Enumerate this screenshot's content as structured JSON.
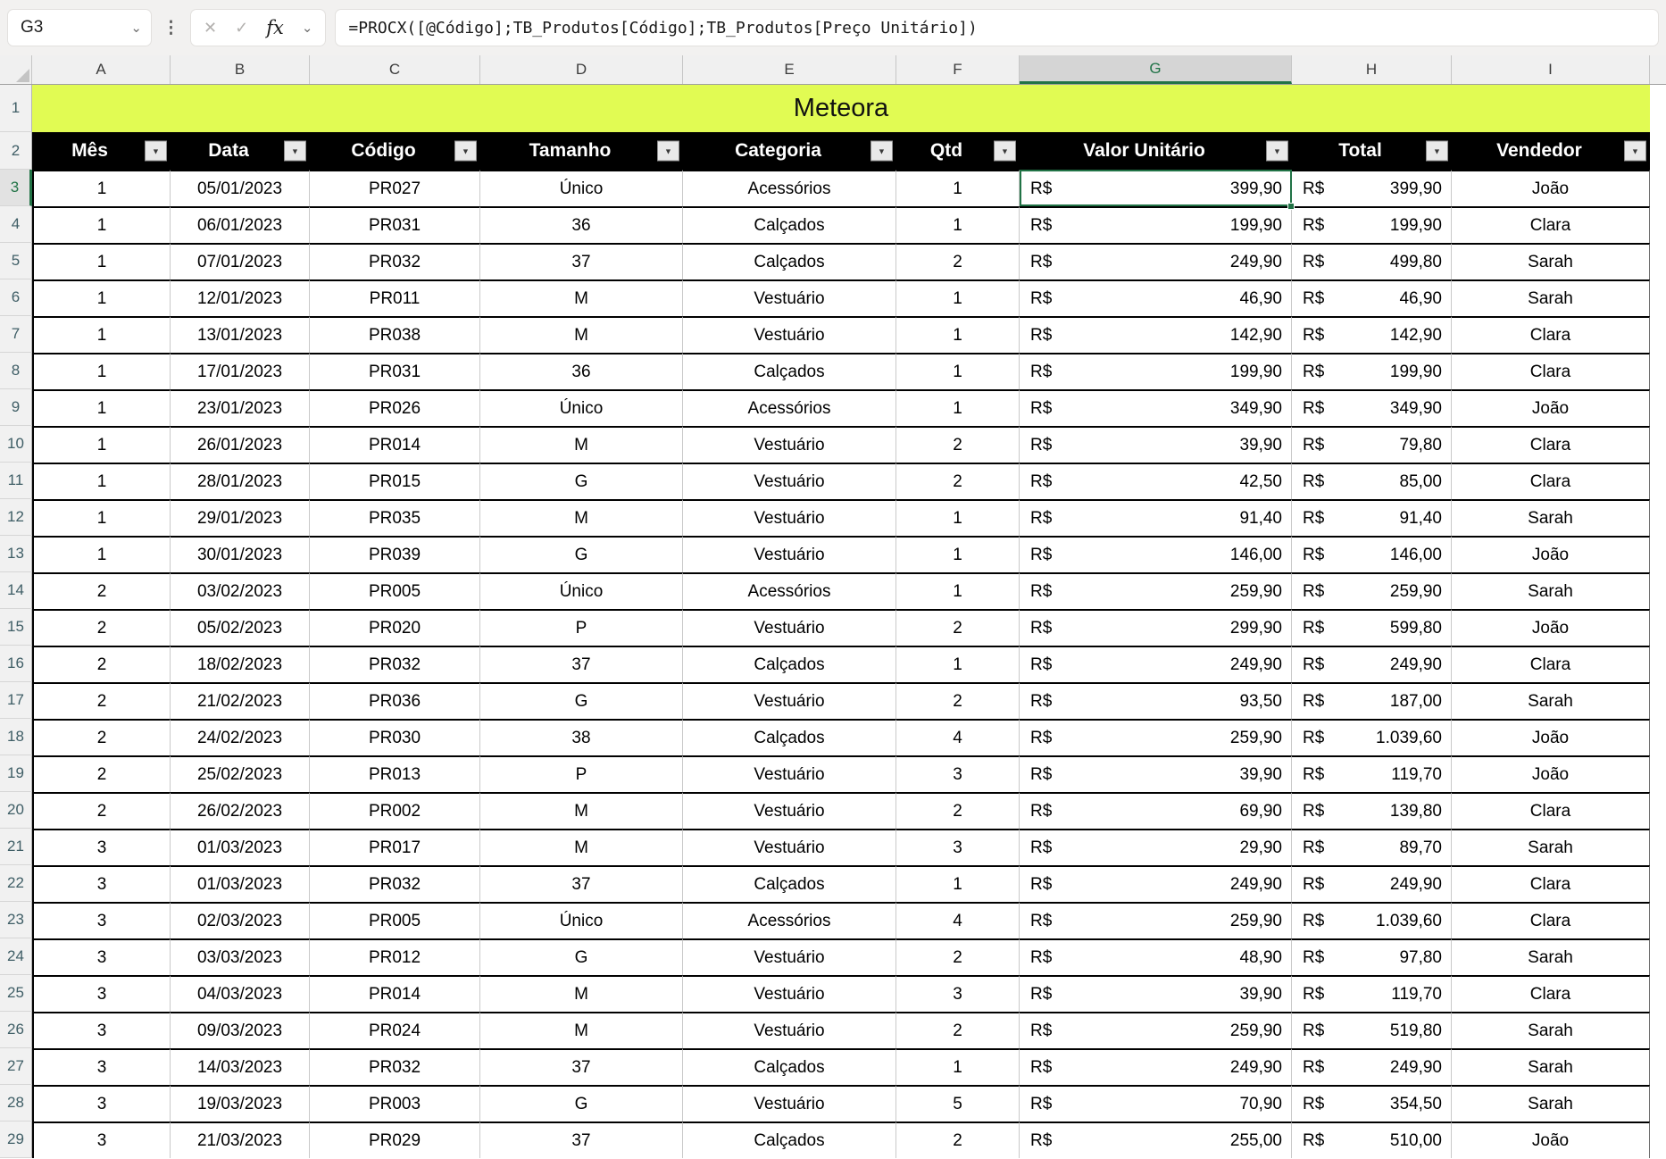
{
  "colors": {
    "title_bg": "#E1FB53",
    "table_header_bg": "#000000",
    "selection_green": "#217346"
  },
  "icons": {
    "chevron_down": "⌄",
    "more_options": "⋮",
    "cancel": "✕",
    "confirm": "✓",
    "fx": "fx",
    "filter": "▼"
  },
  "formula_bar": {
    "name_box_value": "G3",
    "formula": "=PROCX([@Código];TB_Produtos[Código];TB_Produtos[Preço Unitário])"
  },
  "sheet": {
    "title": "Meteora",
    "title_row_number": "1",
    "header_row_number": "2",
    "column_letters": [
      "A",
      "B",
      "C",
      "D",
      "E",
      "F",
      "G",
      "H",
      "I"
    ],
    "selected_cell": {
      "column": "G",
      "row": "3"
    },
    "table_headers": [
      "Mês",
      "Data",
      "Código",
      "Tamanho",
      "Categoria",
      "Qtd",
      "Valor Unitário",
      "Total",
      "Vendedor"
    ],
    "currency_prefix": "R$",
    "rows": [
      {
        "row_num": "3",
        "mes": "1",
        "data": "05/01/2023",
        "codigo": "PR027",
        "tamanho": "Único",
        "categoria": "Acessórios",
        "qtd": "1",
        "valor_unitario": "399,90",
        "total": "399,90",
        "vendedor": "João"
      },
      {
        "row_num": "4",
        "mes": "1",
        "data": "06/01/2023",
        "codigo": "PR031",
        "tamanho": "36",
        "categoria": "Calçados",
        "qtd": "1",
        "valor_unitario": "199,90",
        "total": "199,90",
        "vendedor": "Clara"
      },
      {
        "row_num": "5",
        "mes": "1",
        "data": "07/01/2023",
        "codigo": "PR032",
        "tamanho": "37",
        "categoria": "Calçados",
        "qtd": "2",
        "valor_unitario": "249,90",
        "total": "499,80",
        "vendedor": "Sarah"
      },
      {
        "row_num": "6",
        "mes": "1",
        "data": "12/01/2023",
        "codigo": "PR011",
        "tamanho": "M",
        "categoria": "Vestuário",
        "qtd": "1",
        "valor_unitario": "46,90",
        "total": "46,90",
        "vendedor": "Sarah"
      },
      {
        "row_num": "7",
        "mes": "1",
        "data": "13/01/2023",
        "codigo": "PR038",
        "tamanho": "M",
        "categoria": "Vestuário",
        "qtd": "1",
        "valor_unitario": "142,90",
        "total": "142,90",
        "vendedor": "Clara"
      },
      {
        "row_num": "8",
        "mes": "1",
        "data": "17/01/2023",
        "codigo": "PR031",
        "tamanho": "36",
        "categoria": "Calçados",
        "qtd": "1",
        "valor_unitario": "199,90",
        "total": "199,90",
        "vendedor": "Clara"
      },
      {
        "row_num": "9",
        "mes": "1",
        "data": "23/01/2023",
        "codigo": "PR026",
        "tamanho": "Único",
        "categoria": "Acessórios",
        "qtd": "1",
        "valor_unitario": "349,90",
        "total": "349,90",
        "vendedor": "João"
      },
      {
        "row_num": "10",
        "mes": "1",
        "data": "26/01/2023",
        "codigo": "PR014",
        "tamanho": "M",
        "categoria": "Vestuário",
        "qtd": "2",
        "valor_unitario": "39,90",
        "total": "79,80",
        "vendedor": "Clara"
      },
      {
        "row_num": "11",
        "mes": "1",
        "data": "28/01/2023",
        "codigo": "PR015",
        "tamanho": "G",
        "categoria": "Vestuário",
        "qtd": "2",
        "valor_unitario": "42,50",
        "total": "85,00",
        "vendedor": "Clara"
      },
      {
        "row_num": "12",
        "mes": "1",
        "data": "29/01/2023",
        "codigo": "PR035",
        "tamanho": "M",
        "categoria": "Vestuário",
        "qtd": "1",
        "valor_unitario": "91,40",
        "total": "91,40",
        "vendedor": "Sarah"
      },
      {
        "row_num": "13",
        "mes": "1",
        "data": "30/01/2023",
        "codigo": "PR039",
        "tamanho": "G",
        "categoria": "Vestuário",
        "qtd": "1",
        "valor_unitario": "146,00",
        "total": "146,00",
        "vendedor": "João"
      },
      {
        "row_num": "14",
        "mes": "2",
        "data": "03/02/2023",
        "codigo": "PR005",
        "tamanho": "Único",
        "categoria": "Acessórios",
        "qtd": "1",
        "valor_unitario": "259,90",
        "total": "259,90",
        "vendedor": "Sarah"
      },
      {
        "row_num": "15",
        "mes": "2",
        "data": "05/02/2023",
        "codigo": "PR020",
        "tamanho": "P",
        "categoria": "Vestuário",
        "qtd": "2",
        "valor_unitario": "299,90",
        "total": "599,80",
        "vendedor": "João"
      },
      {
        "row_num": "16",
        "mes": "2",
        "data": "18/02/2023",
        "codigo": "PR032",
        "tamanho": "37",
        "categoria": "Calçados",
        "qtd": "1",
        "valor_unitario": "249,90",
        "total": "249,90",
        "vendedor": "Clara"
      },
      {
        "row_num": "17",
        "mes": "2",
        "data": "21/02/2023",
        "codigo": "PR036",
        "tamanho": "G",
        "categoria": "Vestuário",
        "qtd": "2",
        "valor_unitario": "93,50",
        "total": "187,00",
        "vendedor": "Sarah"
      },
      {
        "row_num": "18",
        "mes": "2",
        "data": "24/02/2023",
        "codigo": "PR030",
        "tamanho": "38",
        "categoria": "Calçados",
        "qtd": "4",
        "valor_unitario": "259,90",
        "total": "1.039,60",
        "vendedor": "João"
      },
      {
        "row_num": "19",
        "mes": "2",
        "data": "25/02/2023",
        "codigo": "PR013",
        "tamanho": "P",
        "categoria": "Vestuário",
        "qtd": "3",
        "valor_unitario": "39,90",
        "total": "119,70",
        "vendedor": "João"
      },
      {
        "row_num": "20",
        "mes": "2",
        "data": "26/02/2023",
        "codigo": "PR002",
        "tamanho": "M",
        "categoria": "Vestuário",
        "qtd": "2",
        "valor_unitario": "69,90",
        "total": "139,80",
        "vendedor": "Clara"
      },
      {
        "row_num": "21",
        "mes": "3",
        "data": "01/03/2023",
        "codigo": "PR017",
        "tamanho": "M",
        "categoria": "Vestuário",
        "qtd": "3",
        "valor_unitario": "29,90",
        "total": "89,70",
        "vendedor": "Sarah"
      },
      {
        "row_num": "22",
        "mes": "3",
        "data": "01/03/2023",
        "codigo": "PR032",
        "tamanho": "37",
        "categoria": "Calçados",
        "qtd": "1",
        "valor_unitario": "249,90",
        "total": "249,90",
        "vendedor": "Clara"
      },
      {
        "row_num": "23",
        "mes": "3",
        "data": "02/03/2023",
        "codigo": "PR005",
        "tamanho": "Único",
        "categoria": "Acessórios",
        "qtd": "4",
        "valor_unitario": "259,90",
        "total": "1.039,60",
        "vendedor": "Clara"
      },
      {
        "row_num": "24",
        "mes": "3",
        "data": "03/03/2023",
        "codigo": "PR012",
        "tamanho": "G",
        "categoria": "Vestuário",
        "qtd": "2",
        "valor_unitario": "48,90",
        "total": "97,80",
        "vendedor": "Sarah"
      },
      {
        "row_num": "25",
        "mes": "3",
        "data": "04/03/2023",
        "codigo": "PR014",
        "tamanho": "M",
        "categoria": "Vestuário",
        "qtd": "3",
        "valor_unitario": "39,90",
        "total": "119,70",
        "vendedor": "Clara"
      },
      {
        "row_num": "26",
        "mes": "3",
        "data": "09/03/2023",
        "codigo": "PR024",
        "tamanho": "M",
        "categoria": "Vestuário",
        "qtd": "2",
        "valor_unitario": "259,90",
        "total": "519,80",
        "vendedor": "Sarah"
      },
      {
        "row_num": "27",
        "mes": "3",
        "data": "14/03/2023",
        "codigo": "PR032",
        "tamanho": "37",
        "categoria": "Calçados",
        "qtd": "1",
        "valor_unitario": "249,90",
        "total": "249,90",
        "vendedor": "Sarah"
      },
      {
        "row_num": "28",
        "mes": "3",
        "data": "19/03/2023",
        "codigo": "PR003",
        "tamanho": "G",
        "categoria": "Vestuário",
        "qtd": "5",
        "valor_unitario": "70,90",
        "total": "354,50",
        "vendedor": "Sarah"
      },
      {
        "row_num": "29",
        "mes": "3",
        "data": "21/03/2023",
        "codigo": "PR029",
        "tamanho": "37",
        "categoria": "Calçados",
        "qtd": "2",
        "valor_unitario": "255,00",
        "total": "510,00",
        "vendedor": "João"
      }
    ]
  }
}
